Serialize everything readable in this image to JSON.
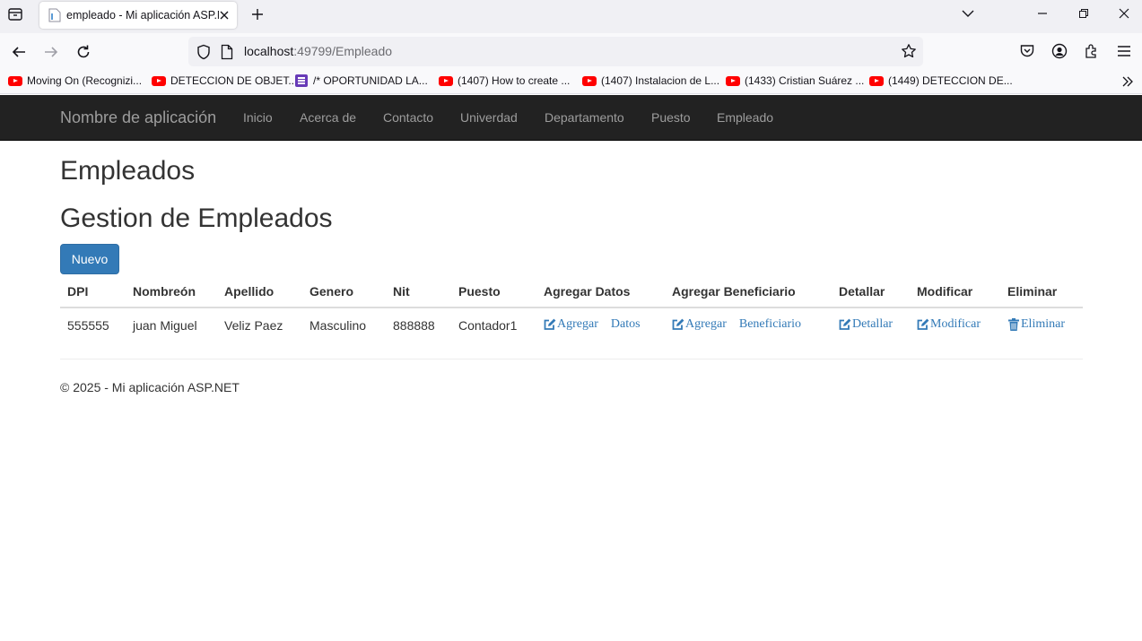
{
  "browser": {
    "tab_title": "empleado - Mi aplicación ASP.NET",
    "url_host": "localhost",
    "url_path": ":49799/Empleado",
    "bookmarks": [
      {
        "label": "Moving On (Recognizi...",
        "icon": "youtube-icon"
      },
      {
        "label": "DETECCION DE OBJET...",
        "icon": "youtube-icon"
      },
      {
        "label": "/* OPORTUNIDAD LA...",
        "icon": "forms-icon"
      },
      {
        "label": "(1407) How to create ...",
        "icon": "youtube-icon"
      },
      {
        "label": "(1407) Instalacion de L...",
        "icon": "youtube-icon"
      },
      {
        "label": "(1433) Cristian Suárez ...",
        "icon": "youtube-icon"
      },
      {
        "label": "(1449) DETECCION DE...",
        "icon": "youtube-icon"
      }
    ]
  },
  "site": {
    "brand": "Nombre de aplicación",
    "menu": [
      "Inicio",
      "Acerca de",
      "Contacto",
      "Univerdad",
      "Departamento",
      "Puesto",
      "Empleado"
    ]
  },
  "page": {
    "title": "Empleados",
    "subtitle": "Gestion de Empleados",
    "new_button": "Nuevo"
  },
  "table": {
    "headers": [
      "DPI",
      "Nombreón",
      "Apellido",
      "Genero",
      "Nit",
      "Puesto",
      "Agregar Datos",
      "Agregar Beneficiario",
      "Detallar",
      "Modificar",
      "Eliminar"
    ],
    "rows": [
      {
        "dpi": "555555",
        "nombre": "juan Miguel",
        "apellido": "Veliz Paez",
        "genero": "Masculino",
        "nit": "888888",
        "puesto": "Contador1",
        "agregar_datos": [
          "Agregar",
          "Datos"
        ],
        "agregar_beneficiario": [
          "Agregar",
          "Beneficiario"
        ],
        "detallar": "Detallar",
        "modificar": "Modificar",
        "eliminar": "Eliminar"
      }
    ]
  },
  "footer": "© 2025 - Mi aplicación ASP.NET",
  "colors": {
    "navbar_bg": "#222222",
    "nav_text": "#9d9d9d",
    "primary": "#337ab7",
    "link": "#337ab7"
  }
}
